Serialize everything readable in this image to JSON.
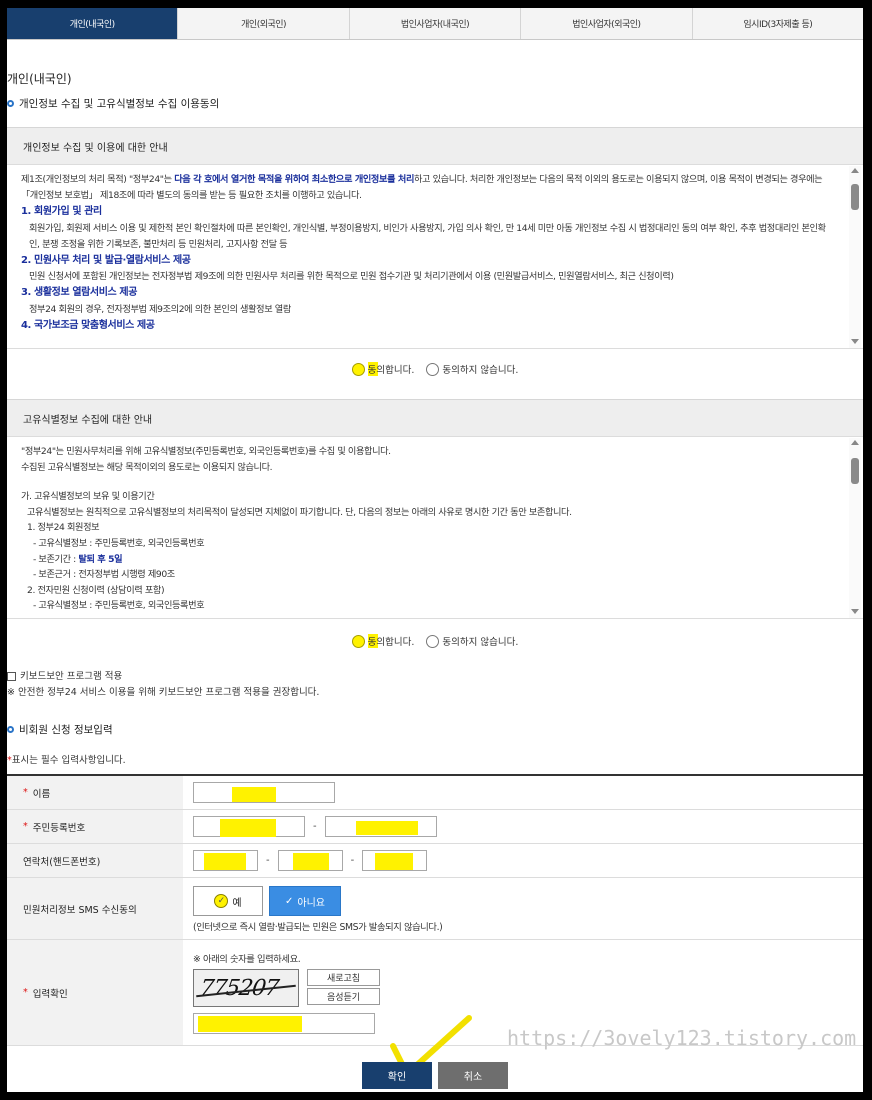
{
  "tabs": [
    {
      "label": "개인(내국인)",
      "active": true
    },
    {
      "label": "개인(외국인)",
      "active": false
    },
    {
      "label": "법인사업자(내국인)",
      "active": false
    },
    {
      "label": "법인사업자(외국인)",
      "active": false
    },
    {
      "label": "임시ID(3자제출 등)",
      "active": false
    }
  ],
  "page_title": "개인(내국인)",
  "section_consent_title": "개인정보 수집 및 고유식별정보 수집 이용동의",
  "privacy": {
    "header": "개인정보 수집 및 이용에 대한 안내",
    "intro_1": "제1조(개인정보의 처리 목적) \"정부24\"는 ",
    "intro_hl_1": "다음 각 호에서 열거한 목적을 위하여 최소한으로 개인정보를 처리",
    "intro_2": "하고 있습니다. 처리한 개인정보는 다음의 목적 이외의 용도로는 이용되지 않으며, 이용 목적이 변경되는 경우에는 「개인정보 보호법」 제18조에 따라 별도의 동의를 받는 등 필요한 조치를 이행하고 있습니다.",
    "h1": "1. 회원가입 및 관리",
    "p1": "회원가입, 회원제 서비스 이용 및 제한적 본인 확인절차에 따른 본인확인, 개인식별, 부정이용방지, 비인가 사용방지, 가입 의사 확인, 만 14세 미만 아동 개인정보 수집 시 법정대리인 동의 여부 확인, 추후 법정대리인 본인확인, 분쟁 조정을 위한 기록보존, 불만처리 등 민원처리, 고지사항 전달 등",
    "h2": "2. 민원사무 처리 및 발급·열람서비스 제공",
    "p2": "민원 신청서에 포함된 개인정보는 전자정부법 제9조에 의한 민원사무 처리를 위한 목적으로 민원 접수기관 및 처리기관에서 이용 (민원발급서비스, 민원열람서비스, 최근 신청이력)",
    "h3": "3. 생활정보 열람서비스 제공",
    "p3": "정부24 회원의 경우, 전자정부법 제9조의2에 의한 본인의 생활정보 열람",
    "h4": "4. 국가보조금 맞춤형서비스 제공",
    "agree": "동의합니다.",
    "disagree": "동의하지 않습니다."
  },
  "unique_id": {
    "header": "고유식별정보 수집에 대한 안내",
    "l1": "\"정부24\"는 민원사무처리를 위해 고유식별정보(주민등록번호, 외국인등록번호)를 수집 및 이용합니다.",
    "l2": "수집된 고유식별정보는 해당 목적이외의 용도로는 이용되지 않습니다.",
    "l3": "가. 고유식별정보의 보유 및 이용기간",
    "l4": "고유식별정보는 원칙적으로 고유식별정보의 처리목적이 달성되면 지체없이 파기합니다. 단, 다음의 정보는 아래의 사유로 명시한 기간 동안 보존합니다.",
    "l5": "1. 정부24 회원정보",
    "l6": "- 고유식별정보 : 주민등록번호, 외국인등록번호",
    "l7a": "- 보존기간 : ",
    "l7b": "탈퇴 후 5일",
    "l8": "- 보존근거 : 전자정부법 시행령 제90조",
    "l9": "2. 전자민원 신청이력 (상담이력 포함)",
    "l10": "- 고유식별정보 : 주민등록번호, 외국인등록번호",
    "agree": "동의합니다.",
    "disagree": "동의하지 않습니다."
  },
  "keyboard": {
    "label": "키보드보안 프로그램 적용",
    "note": "※ 안전한 정부24 서비스 이용을 위해 키보드보안 프로그램 적용을 권장합니다."
  },
  "section_input_title": "비회원 신청 정보입력",
  "required_note": "표시는 필수 입력사항입니다.",
  "form": {
    "name_label": "이름",
    "rrn_label": "주민등록번호",
    "phone_label": "연락처(핸드폰번호)",
    "sms_label": "민원처리정보 SMS 수신동의",
    "sms_yes": "예",
    "sms_no": "아니요",
    "sms_note": "(인터넷으로 즉시 열람·발급되는 민원은 SMS가 발송되지 않습니다.)",
    "captcha_label": "입력확인",
    "captcha_note": "※ 아래의 숫자를 입력하세요.",
    "captcha_digits": "775207",
    "refresh": "새로고침",
    "audio": "음성듣기",
    "dash": "-"
  },
  "buttons": {
    "ok": "확인",
    "cancel": "취소"
  },
  "watermark": "https://3ovely123.tistory.com",
  "colors": {
    "nav": "#183f6e",
    "highlight": "#fff200",
    "accent_blue": "#3a8de3",
    "required": "#dd1111"
  }
}
